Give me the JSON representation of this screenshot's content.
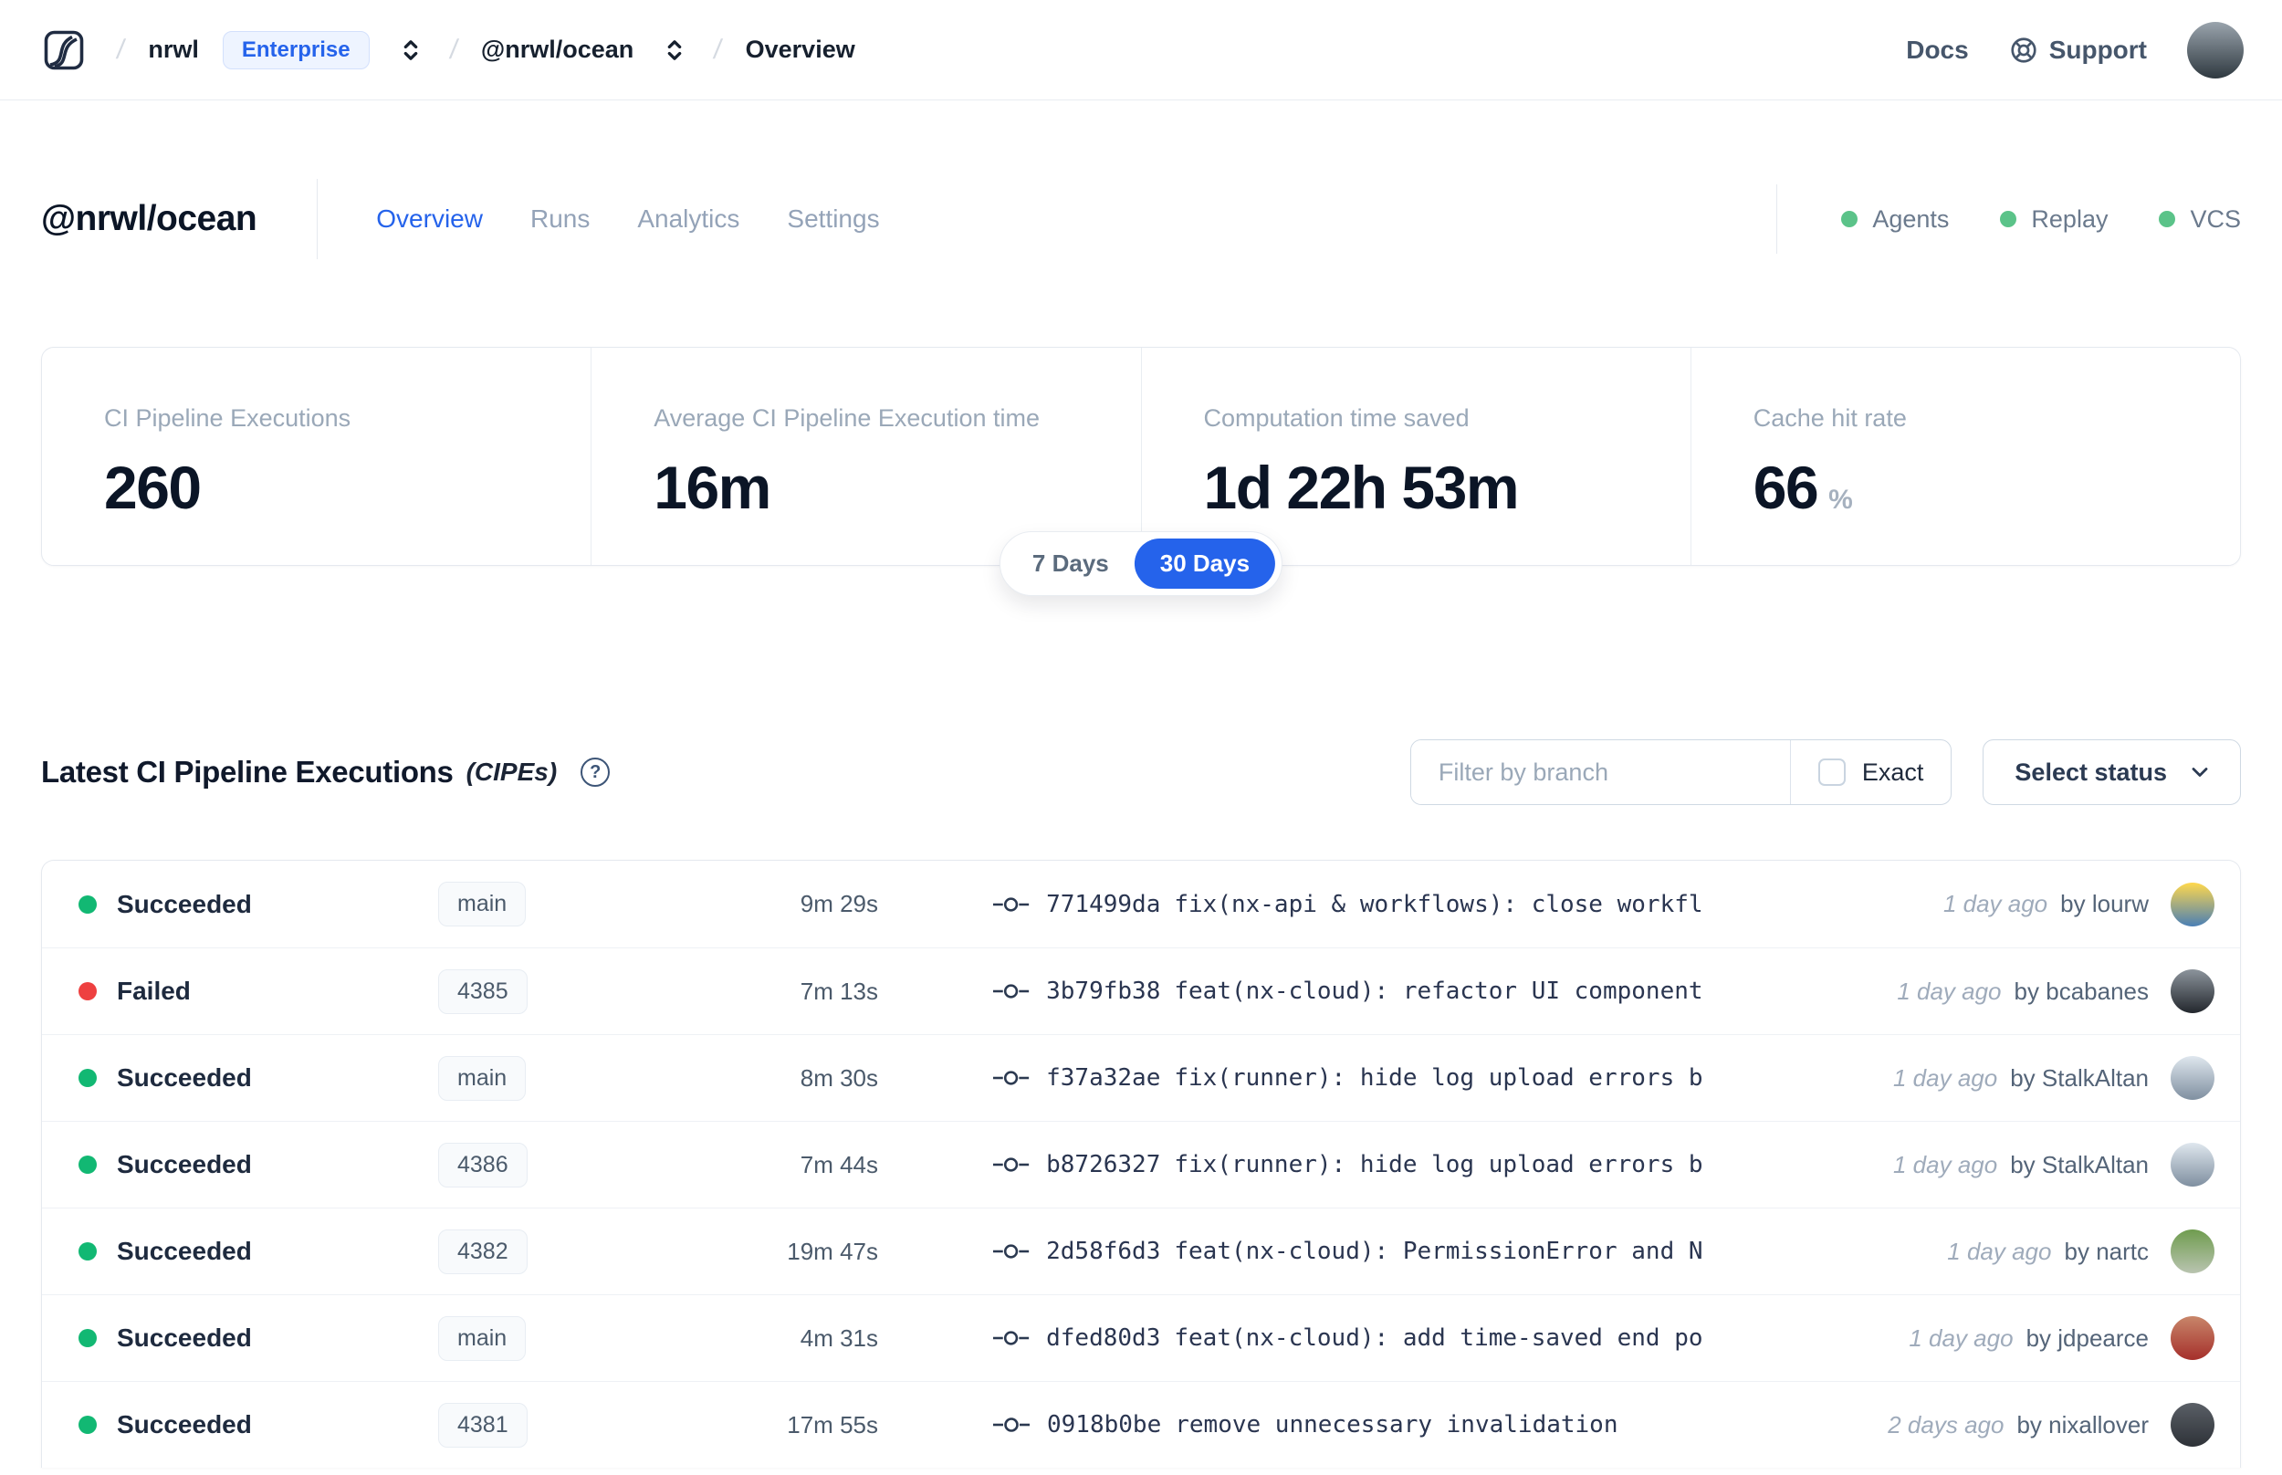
{
  "nav": {
    "separator": "/",
    "org": {
      "name": "nrwl",
      "badge": "Enterprise"
    },
    "workspace": "@nrwl/ocean",
    "page": "Overview",
    "docs_label": "Docs",
    "support_label": "Support"
  },
  "header": {
    "title": "@nrwl/ocean",
    "tabs": [
      {
        "label": "Overview",
        "active": true
      },
      {
        "label": "Runs",
        "active": false
      },
      {
        "label": "Analytics",
        "active": false
      },
      {
        "label": "Settings",
        "active": false
      }
    ],
    "services": [
      {
        "label": "Agents"
      },
      {
        "label": "Replay"
      },
      {
        "label": "VCS"
      }
    ]
  },
  "stats": {
    "cards": [
      {
        "label": "CI Pipeline Executions",
        "value": "260",
        "unit": ""
      },
      {
        "label": "Average CI Pipeline Execution time",
        "value": "16m",
        "unit": ""
      },
      {
        "label": "Computation time saved",
        "value": "1d 22h 53m",
        "unit": ""
      },
      {
        "label": "Cache hit rate",
        "value": "66",
        "unit": "%"
      }
    ],
    "toggle": {
      "options": [
        "7 Days",
        "30 Days"
      ],
      "selected": 1
    }
  },
  "cipes": {
    "heading": "Latest CI Pipeline Executions",
    "heading_suffix": "(CIPEs)",
    "help_glyph": "?",
    "filter": {
      "placeholder": "Filter by branch",
      "exact_label": "Exact",
      "status_label": "Select status"
    },
    "by_prefix": "by",
    "rows": [
      {
        "status": "Succeeded",
        "status_color": "#12b873",
        "branch": "main",
        "duration": "9m 29s",
        "hash": "771499da",
        "message": "fix(nx-api & workflows): close workfl…",
        "time_ago": "1 day ago",
        "author": "lourw",
        "avatar": [
          "#ffd84d",
          "#4a7fb5"
        ]
      },
      {
        "status": "Failed",
        "status_color": "#ee4040",
        "branch": "4385",
        "duration": "7m 13s",
        "hash": "3b79fb38",
        "message": "feat(nx-cloud): refactor UI component…",
        "time_ago": "1 day ago",
        "author": "bcabanes",
        "avatar": [
          "#8c949c",
          "#23272d"
        ]
      },
      {
        "status": "Succeeded",
        "status_color": "#12b873",
        "branch": "main",
        "duration": "8m 30s",
        "hash": "f37a32ae",
        "message": "fix(runner): hide log upload errors b…",
        "time_ago": "1 day ago",
        "author": "StalkAltan",
        "avatar": [
          "#dfe7ee",
          "#7f8fa0"
        ]
      },
      {
        "status": "Succeeded",
        "status_color": "#12b873",
        "branch": "4386",
        "duration": "7m 44s",
        "hash": "b8726327",
        "message": "fix(runner): hide log upload errors b…",
        "time_ago": "1 day ago",
        "author": "StalkAltan",
        "avatar": [
          "#dfe7ee",
          "#7f8fa0"
        ]
      },
      {
        "status": "Succeeded",
        "status_color": "#12b873",
        "branch": "4382",
        "duration": "19m 47s",
        "hash": "2d58f6d3",
        "message": "feat(nx-cloud): PermissionError and N…",
        "time_ago": "1 day ago",
        "author": "nartc",
        "avatar": [
          "#6f9c4f",
          "#b9c4b0"
        ]
      },
      {
        "status": "Succeeded",
        "status_color": "#12b873",
        "branch": "main",
        "duration": "4m 31s",
        "hash": "dfed80d3",
        "message": "feat(nx-cloud): add time-saved end po…",
        "time_ago": "1 day ago",
        "author": "jdpearce",
        "avatar": [
          "#c8866a",
          "#a52f2b"
        ]
      },
      {
        "status": "Succeeded",
        "status_color": "#12b873",
        "branch": "4381",
        "duration": "17m 55s",
        "hash": "0918b0be",
        "message": "remove unnecessary invalidation",
        "time_ago": "2 days ago",
        "author": "nixallover",
        "avatar": [
          "#5a5f66",
          "#2e3238"
        ]
      }
    ]
  },
  "colors": {
    "accent": "#2563eb",
    "success": "#12b873",
    "danger": "#ee4040",
    "service_dot": "#5bc389",
    "nav_avatar": [
      "#9aa4ad",
      "#2f3940"
    ]
  }
}
